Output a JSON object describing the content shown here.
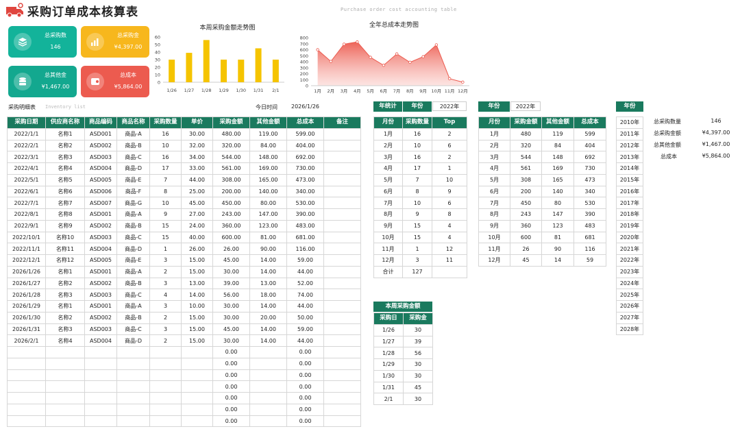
{
  "header": {
    "title": "采购订单成本核算表",
    "subtitle": "Purchase order cost accounting table"
  },
  "cards": [
    {
      "label": "总采购数",
      "value": "146",
      "color": "#13b39a",
      "icon": "layers-icon"
    },
    {
      "label": "总采购金",
      "value": "¥4,397.00",
      "color": "#f7b71d",
      "icon": "bar-chart-icon"
    },
    {
      "label": "总其他金",
      "value": "¥1,467.00",
      "color": "#13a88f",
      "icon": "database-icon"
    },
    {
      "label": "总成本",
      "value": "¥5,864.00",
      "color": "#ec5b4f",
      "icon": "coins-icon"
    }
  ],
  "charts": {
    "weekly": {
      "title": "本周采购金额走势图"
    },
    "yearly": {
      "title": "全年总成本走势图"
    }
  },
  "chart_data": [
    {
      "type": "bar",
      "title": "本周采购金额走势图",
      "categories": [
        "1/26",
        "1/27",
        "1/28",
        "1/29",
        "1/30",
        "1/31",
        "2/1"
      ],
      "values": [
        30,
        39,
        56,
        30,
        30,
        45,
        30
      ],
      "ylim": [
        0,
        60
      ],
      "yticks": [
        "0",
        "10",
        "20",
        "30",
        "40",
        "50",
        "60"
      ],
      "color": "#f5c400"
    },
    {
      "type": "area",
      "title": "全年总成本走势图",
      "categories": [
        "1月",
        "2月",
        "3月",
        "4月",
        "5月",
        "6月",
        "7月",
        "8月",
        "9月",
        "10月",
        "11月",
        "12月"
      ],
      "values": [
        599,
        404,
        692,
        730,
        473,
        340,
        530,
        390,
        483,
        681,
        116,
        59
      ],
      "ylim": [
        0,
        800
      ],
      "yticks": [
        "0",
        "100",
        "200",
        "300",
        "400",
        "500",
        "600",
        "700",
        "800"
      ],
      "color": "#ec5b4f"
    }
  ],
  "detail": {
    "label": "采购明细表",
    "label_en": "Inventory list",
    "today_label": "今日时间",
    "today_value": "2026/1/26",
    "headers": [
      "采购日期",
      "供应商名称",
      "商品编码",
      "商品名称",
      "采购数量",
      "单价",
      "采购金额",
      "其他金额",
      "总成本",
      "备注"
    ],
    "rows": [
      [
        "2022/1/1",
        "名称1",
        "ASD001",
        "商品-A",
        "16",
        "30.00",
        "480.00",
        "119.00",
        "599.00",
        ""
      ],
      [
        "2022/2/1",
        "名称2",
        "ASD002",
        "商品-B",
        "10",
        "32.00",
        "320.00",
        "84.00",
        "404.00",
        ""
      ],
      [
        "2022/3/1",
        "名称3",
        "ASD003",
        "商品-C",
        "16",
        "34.00",
        "544.00",
        "148.00",
        "692.00",
        ""
      ],
      [
        "2022/4/1",
        "名称4",
        "ASD004",
        "商品-D",
        "17",
        "33.00",
        "561.00",
        "169.00",
        "730.00",
        ""
      ],
      [
        "2022/5/1",
        "名称5",
        "ASD005",
        "商品-E",
        "7",
        "44.00",
        "308.00",
        "165.00",
        "473.00",
        ""
      ],
      [
        "2022/6/1",
        "名称6",
        "ASD006",
        "商品-F",
        "8",
        "25.00",
        "200.00",
        "140.00",
        "340.00",
        ""
      ],
      [
        "2022/7/1",
        "名称7",
        "ASD007",
        "商品-G",
        "10",
        "45.00",
        "450.00",
        "80.00",
        "530.00",
        ""
      ],
      [
        "2022/8/1",
        "名称8",
        "ASD001",
        "商品-A",
        "9",
        "27.00",
        "243.00",
        "147.00",
        "390.00",
        ""
      ],
      [
        "2022/9/1",
        "名称9",
        "ASD002",
        "商品-B",
        "15",
        "24.00",
        "360.00",
        "123.00",
        "483.00",
        ""
      ],
      [
        "2022/10/1",
        "名称10",
        "ASD003",
        "商品-C",
        "15",
        "40.00",
        "600.00",
        "81.00",
        "681.00",
        ""
      ],
      [
        "2022/11/1",
        "名称11",
        "ASD004",
        "商品-D",
        "1",
        "26.00",
        "26.00",
        "90.00",
        "116.00",
        ""
      ],
      [
        "2022/12/1",
        "名称12",
        "ASD005",
        "商品-E",
        "3",
        "15.00",
        "45.00",
        "14.00",
        "59.00",
        ""
      ],
      [
        "2026/1/26",
        "名称1",
        "ASD001",
        "商品-A",
        "2",
        "15.00",
        "30.00",
        "14.00",
        "44.00",
        ""
      ],
      [
        "2026/1/27",
        "名称2",
        "ASD002",
        "商品-B",
        "3",
        "13.00",
        "39.00",
        "13.00",
        "52.00",
        ""
      ],
      [
        "2026/1/28",
        "名称3",
        "ASD003",
        "商品-C",
        "4",
        "14.00",
        "56.00",
        "18.00",
        "74.00",
        ""
      ],
      [
        "2026/1/29",
        "名称1",
        "ASD001",
        "商品-A",
        "3",
        "10.00",
        "30.00",
        "14.00",
        "44.00",
        ""
      ],
      [
        "2026/1/30",
        "名称2",
        "ASD002",
        "商品-B",
        "2",
        "15.00",
        "30.00",
        "20.00",
        "50.00",
        ""
      ],
      [
        "2026/1/31",
        "名称3",
        "ASD003",
        "商品-C",
        "3",
        "15.00",
        "45.00",
        "14.00",
        "59.00",
        ""
      ],
      [
        "2026/2/1",
        "名称4",
        "ASD004",
        "商品-D",
        "2",
        "15.00",
        "30.00",
        "14.00",
        "44.00",
        ""
      ],
      [
        "",
        "",
        "",
        "",
        "",
        "",
        "0.00",
        "",
        "0.00",
        ""
      ],
      [
        "",
        "",
        "",
        "",
        "",
        "",
        "0.00",
        "",
        "0.00",
        ""
      ],
      [
        "",
        "",
        "",
        "",
        "",
        "",
        "0.00",
        "",
        "0.00",
        ""
      ],
      [
        "",
        "",
        "",
        "",
        "",
        "",
        "0.00",
        "",
        "0.00",
        ""
      ],
      [
        "",
        "",
        "",
        "",
        "",
        "",
        "0.00",
        "",
        "0.00",
        ""
      ],
      [
        "",
        "",
        "",
        "",
        "",
        "",
        "0.00",
        "",
        "0.00",
        ""
      ],
      [
        "",
        "",
        "",
        "",
        "",
        "",
        "0.00",
        "",
        "0.00",
        ""
      ]
    ]
  },
  "stats": {
    "annual_label": "年统计",
    "year_label": "年份",
    "year_value": "2022年",
    "headers": [
      "月份",
      "采购数量",
      "Top"
    ],
    "rows": [
      [
        "1月",
        "16",
        "2"
      ],
      [
        "2月",
        "10",
        "6"
      ],
      [
        "3月",
        "16",
        "2"
      ],
      [
        "4月",
        "17",
        "1"
      ],
      [
        "5月",
        "7",
        "10"
      ],
      [
        "6月",
        "8",
        "9"
      ],
      [
        "7月",
        "10",
        "6"
      ],
      [
        "8月",
        "9",
        "8"
      ],
      [
        "9月",
        "15",
        "4"
      ],
      [
        "10月",
        "15",
        "4"
      ],
      [
        "11月",
        "1",
        "12"
      ],
      [
        "12月",
        "3",
        "11"
      ],
      [
        "合计",
        "127",
        ""
      ]
    ]
  },
  "monthly": {
    "year_label": "年份",
    "year_value": "2022年",
    "headers": [
      "月份",
      "采购金额",
      "其他金额",
      "总成本"
    ],
    "rows": [
      [
        "1月",
        "480",
        "119",
        "599"
      ],
      [
        "2月",
        "320",
        "84",
        "404"
      ],
      [
        "3月",
        "544",
        "148",
        "692"
      ],
      [
        "4月",
        "561",
        "169",
        "730"
      ],
      [
        "5月",
        "308",
        "165",
        "473"
      ],
      [
        "6月",
        "200",
        "140",
        "340"
      ],
      [
        "7月",
        "450",
        "80",
        "530"
      ],
      [
        "8月",
        "243",
        "147",
        "390"
      ],
      [
        "9月",
        "360",
        "123",
        "483"
      ],
      [
        "10月",
        "600",
        "81",
        "681"
      ],
      [
        "11月",
        "26",
        "90",
        "116"
      ],
      [
        "12月",
        "45",
        "14",
        "59"
      ]
    ]
  },
  "weekly_table": {
    "title": "本周采购金额",
    "headers": [
      "采购日",
      "采购金"
    ],
    "rows": [
      [
        "1/26",
        "30"
      ],
      [
        "1/27",
        "39"
      ],
      [
        "1/28",
        "56"
      ],
      [
        "1/29",
        "30"
      ],
      [
        "1/30",
        "30"
      ],
      [
        "1/31",
        "45"
      ],
      [
        "2/1",
        "30"
      ]
    ]
  },
  "years": {
    "label": "年份",
    "list": [
      "2010年",
      "2011年",
      "2012年",
      "2013年",
      "2014年",
      "2015年",
      "2016年",
      "2017年",
      "2018年",
      "2019年",
      "2020年",
      "2021年",
      "2022年",
      "2023年",
      "2024年",
      "2025年",
      "2026年",
      "2027年",
      "2028年"
    ]
  },
  "summary": [
    {
      "label": "总采购数量",
      "value": "146"
    },
    {
      "label": "总采购金额",
      "value": "¥4,397.00"
    },
    {
      "label": "总其他金额",
      "value": "¥1,467.00"
    },
    {
      "label": "总成本",
      "value": "¥5,864.00"
    }
  ]
}
